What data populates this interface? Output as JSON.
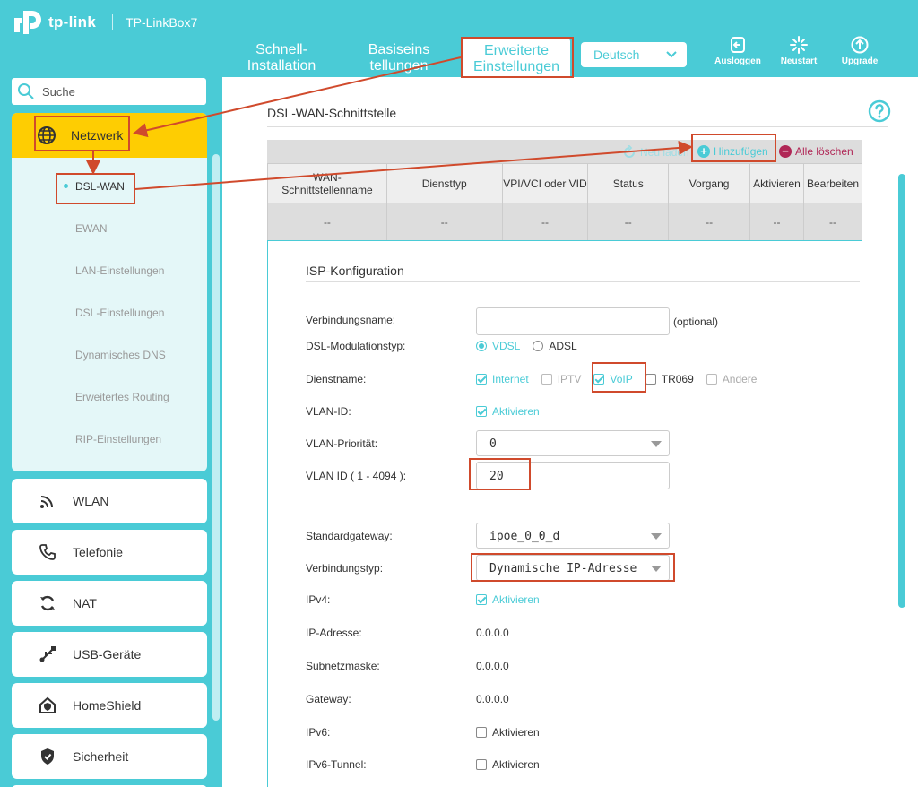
{
  "header": {
    "brand": "tp-link",
    "model": "TP-LinkBox7",
    "nav": {
      "quick_line1": "Schnell-",
      "quick_line2": "Installation",
      "basic_line1": "Basiseins",
      "basic_line2": "tellungen",
      "advanced_line1": "Erweiterte",
      "advanced_line2": "Einstellungen"
    },
    "language": "Deutsch",
    "logout": "Ausloggen",
    "restart": "Neustart",
    "upgrade": "Upgrade"
  },
  "sidebar": {
    "search_placeholder": "Suche",
    "network": {
      "label": "Netzwerk",
      "items": [
        "DSL-WAN",
        "EWAN",
        "LAN-Einstellungen",
        "DSL-Einstellungen",
        "Dynamisches DNS",
        "Erweitertes Routing",
        "RIP-Einstellungen"
      ]
    },
    "menu": [
      "WLAN",
      "Telefonie",
      "NAT",
      "USB-Geräte",
      "HomeShield",
      "Sicherheit"
    ]
  },
  "main": {
    "section_title": "DSL-WAN-Schnittstelle",
    "toolbar": {
      "reload": "Neu laden",
      "add": "Hinzufügen",
      "delete_all": "Alle löschen"
    },
    "table": {
      "headers": [
        "WAN-Schnittstellenname",
        "Diensttyp",
        "VPI/VCI oder VID",
        "Status",
        "Vorgang",
        "Aktivieren",
        "Bearbeiten"
      ],
      "row": [
        "--",
        "--",
        "--",
        "--",
        "--",
        "--",
        "--"
      ]
    },
    "isp": {
      "title": "ISP-Konfiguration",
      "connection_name_label": "Verbindungsname:",
      "connection_name_value": "",
      "optional": "(optional)",
      "dsl_mod_label": "DSL-Modulationstyp:",
      "dsl_mod_options": [
        "VDSL",
        "ADSL"
      ],
      "dsl_mod_selected": "VDSL",
      "service_label": "Dienstname:",
      "services": [
        "Internet",
        "IPTV",
        "VoIP",
        "TR069",
        "Andere"
      ],
      "vlan_id_label": "VLAN-ID:",
      "activate": "Aktivieren",
      "vlan_prio_label": "VLAN-Priorität:",
      "vlan_prio_value": "0",
      "vlan_range_label": "VLAN ID ( 1 - 4094 ):",
      "vlan_value": "20",
      "gateway_label": "Standardgateway:",
      "gateway_value": "ipoe_0_0_d",
      "conn_type_label": "Verbindungstyp:",
      "conn_type_value": "Dynamische IP-Adresse",
      "ipv4_label": "IPv4:",
      "ip_label": "IP-Adresse:",
      "ip_value": "0.0.0.0",
      "subnet_label": "Subnetzmaske:",
      "subnet_value": "0.0.0.0",
      "gw_label": "Gateway:",
      "gw_value": "0.0.0.0",
      "ipv6_label": "IPv6:",
      "ipv6_tunnel_label": "IPv6-Tunnel:"
    }
  },
  "colors": {
    "accent": "#4acbd6",
    "highlight": "#fecd02",
    "annotation": "#d04a2c",
    "danger": "#b02756"
  }
}
